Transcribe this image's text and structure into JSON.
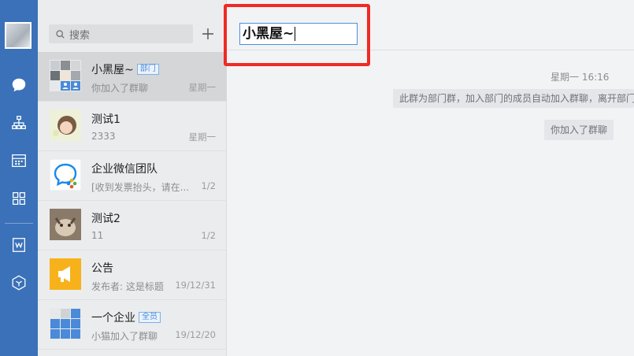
{
  "rail": {
    "icons": [
      "chat-icon",
      "org-icon",
      "calendar-icon",
      "apps-icon",
      "w-doc-icon",
      "cube-icon"
    ]
  },
  "search": {
    "placeholder": "搜索"
  },
  "conversations": [
    {
      "name": "小黑屋~",
      "tag": "部门",
      "preview": "你加入了群聊",
      "time": "星期一"
    },
    {
      "name": "测试1",
      "tag": "",
      "preview": "2333",
      "time": "星期一"
    },
    {
      "name": "企业微信团队",
      "tag": "",
      "preview": "[收到发票抬头，请在...",
      "time": "1/2"
    },
    {
      "name": "测试2",
      "tag": "",
      "preview": "11",
      "time": "1/2"
    },
    {
      "name": "公告",
      "tag": "",
      "preview": "发布者: 这是标题",
      "time": "19/12/31"
    },
    {
      "name": "一个企业",
      "tag": "全员",
      "preview": "小猫加入了群聊",
      "time": "19/12/20"
    }
  ],
  "chat": {
    "title_value": "小黑屋~",
    "timestamp": "星期一 16:16",
    "system_message": "此群为部门群，加入部门的成员自动加入群聊，离开部门",
    "join_message": "你加入了群聊"
  },
  "colors": {
    "rail": "#3a71b8",
    "highlight": "#ee2b24",
    "tag": "#4a8ad8"
  }
}
